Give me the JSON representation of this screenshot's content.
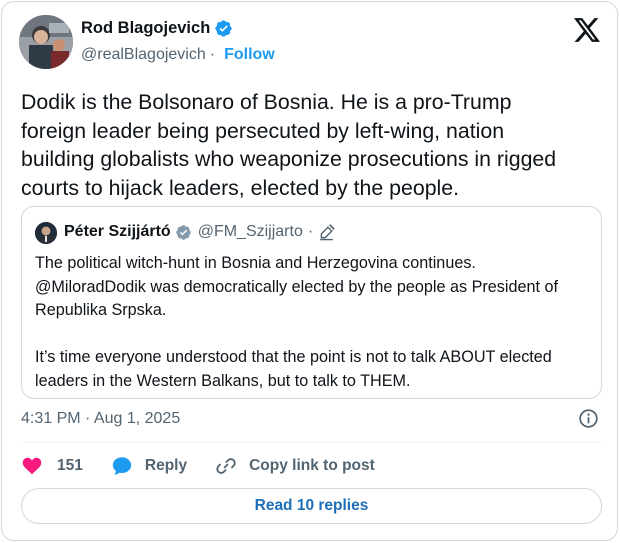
{
  "author": {
    "name": "Rod Blagojevich",
    "handle": "@realBlagojevich",
    "separator": "·",
    "follow_label": "Follow"
  },
  "tweet": {
    "text": "Dodik is the Bolsonaro of Bosnia. He is a pro-Trump\nforeign leader being persecuted by left-wing, nation\nbuilding globalists who weaponize prosecutions in rigged\ncourts to hijack leaders, elected by the people."
  },
  "quote": {
    "name": "Péter Szijjártó",
    "handle": "@FM_Szijjarto",
    "separator": "·",
    "text": "The political witch-hunt in Bosnia and Herzegovina continues.\n@MiloradDodik was democratically elected by the people as President of\nRepublika Srpska.\n\nIt’s time everyone understood that the point is not to talk ABOUT elected\nleaders in the Western Balkans, but to talk to THEM."
  },
  "meta": {
    "timestamp": "4:31 PM · Aug 1, 2025"
  },
  "actions": {
    "like_count": "151",
    "reply_label": "Reply",
    "copy_label": "Copy link to post"
  },
  "read_replies_label": "Read 10 replies",
  "colors": {
    "accent": "#1d9bf0",
    "like": "#f91880",
    "verified": "#1d9bf0",
    "muted": "#536471",
    "border": "#cfd9de"
  },
  "icons": [
    "verified-badge-icon",
    "x-logo-icon",
    "pencil-icon",
    "info-icon",
    "heart-icon",
    "reply-bubble-icon",
    "link-icon"
  ]
}
